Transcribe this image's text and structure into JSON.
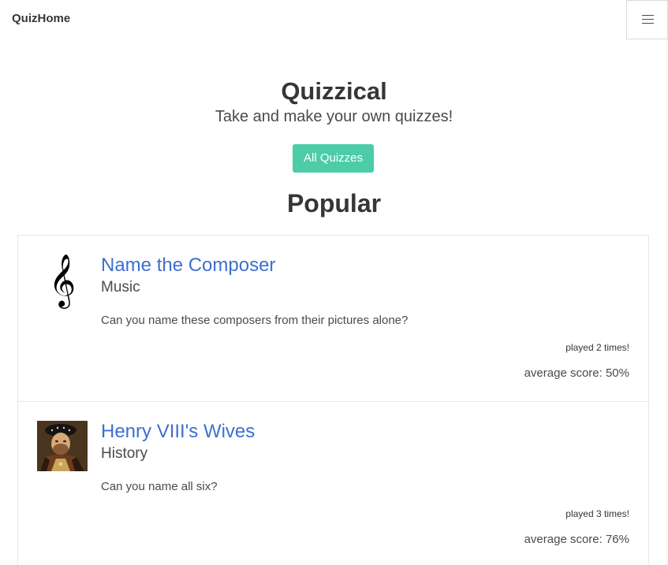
{
  "navbar": {
    "brand": "QuizHome",
    "menu_icon": "hamburger-menu-icon"
  },
  "hero": {
    "title": "Quizzical",
    "subtitle": "Take and make your own quizzes!",
    "all_quizzes_label": "All Quizzes"
  },
  "colors": {
    "accent": "#4ccda7",
    "link": "#3e6fcf"
  },
  "popular": {
    "heading": "Popular",
    "quizzes": [
      {
        "title": "Name the Composer",
        "category": "Music",
        "description": "Can you name these composers from their pictures alone?",
        "played": "played 2 times!",
        "average": "average score: 50%",
        "icon": "treble-clef-icon"
      },
      {
        "title": "Henry VIII's Wives",
        "category": "History",
        "description": "Can you name all six?",
        "played": "played 3 times!",
        "average": "average score: 76%",
        "icon": "henry-viii-portrait"
      }
    ]
  }
}
